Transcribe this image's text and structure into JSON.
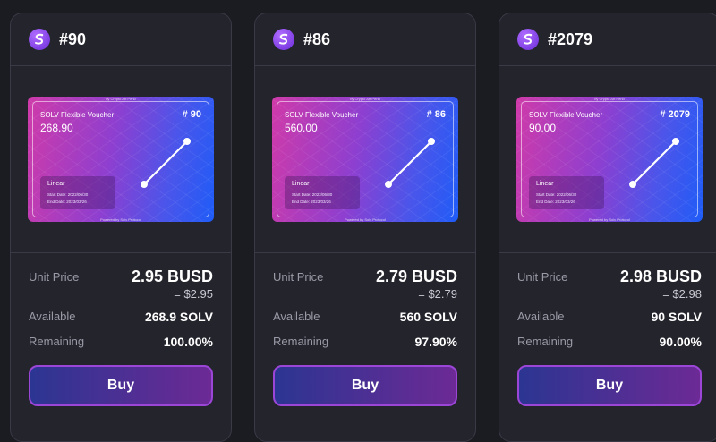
{
  "cards": [
    {
      "id": "#90",
      "voucher": {
        "top_text": "by Crypto Art Pend",
        "title": "SOLV Flexible Voucher",
        "amount": "268.90",
        "number": "# 90",
        "type": "Linear",
        "start_date": "Start Date: 2022/06/30",
        "end_date": "End Date: 2023/03/26",
        "bottom_text": "Powered by Solv Protocol"
      },
      "unit_price_label": "Unit Price",
      "unit_price": "2.95 BUSD",
      "unit_price_usd": "= $2.95",
      "available_label": "Available",
      "available": "268.9 SOLV",
      "remaining_label": "Remaining",
      "remaining": "100.00%",
      "buy_label": "Buy"
    },
    {
      "id": "#86",
      "voucher": {
        "top_text": "by Crypto Art Pend",
        "title": "SOLV Flexible Voucher",
        "amount": "560.00",
        "number": "# 86",
        "type": "Linear",
        "start_date": "Start Date: 2022/06/30",
        "end_date": "End Date: 2023/03/26",
        "bottom_text": "Powered by Solv Protocol"
      },
      "unit_price_label": "Unit Price",
      "unit_price": "2.79 BUSD",
      "unit_price_usd": "= $2.79",
      "available_label": "Available",
      "available": "560 SOLV",
      "remaining_label": "Remaining",
      "remaining": "97.90%",
      "buy_label": "Buy"
    },
    {
      "id": "#2079",
      "voucher": {
        "top_text": "by Crypto Art Pend",
        "title": "SOLV Flexible Voucher",
        "amount": "90.00",
        "number": "# 2079",
        "type": "Linear",
        "start_date": "Start Date: 2022/06/30",
        "end_date": "End Date: 2023/03/26",
        "bottom_text": "Powered by Solv Protocol"
      },
      "unit_price_label": "Unit Price",
      "unit_price": "2.98 BUSD",
      "unit_price_usd": "= $2.98",
      "available_label": "Available",
      "available": "90 SOLV",
      "remaining_label": "Remaining",
      "remaining": "90.00%",
      "buy_label": "Buy"
    }
  ],
  "colors": {
    "background": "#1b1b22",
    "card": "#24242d",
    "button_border": "#9c46d8",
    "label": "#9a9aa6"
  },
  "icons": {
    "logo": "solv-dragon-icon"
  }
}
